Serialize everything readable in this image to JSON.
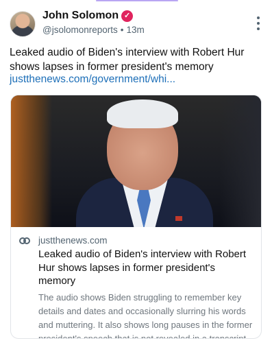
{
  "post": {
    "author_name": "John Solomon",
    "handle": "@jsolomonreports",
    "separator": "•",
    "time": "13m",
    "text": "Leaked audio of Biden's interview with Robert Hur shows lapses in former president's memory",
    "link_text": "justthenews.com/government/whi..."
  },
  "card": {
    "domain": "justthenews.com",
    "title": "Leaked audio of Biden's interview with Robert Hur shows lapses in former president's memory",
    "description": "The audio shows Biden struggling to remember key details and dates and occasionally slurring his words and muttering. It also shows long pauses in the former president's speech that is not revealed in a transcript of the interview."
  },
  "icons": {
    "verified": "verified-check-icon",
    "more": "more-vertical-icon",
    "link": "link-icon"
  },
  "colors": {
    "verified_badge": "#e0245e",
    "link": "#1d6fb8",
    "secondary_text": "#536471"
  }
}
